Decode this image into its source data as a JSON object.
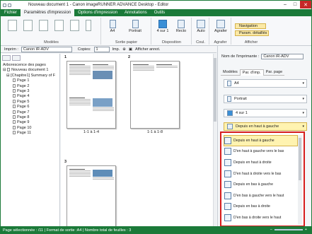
{
  "window": {
    "title": "Nouveau document 1  -  Canon imageRUNNER ADVANCE Desktop - Editor"
  },
  "tabs": [
    "Fichier",
    "Paramètres d'impression",
    "Options d'impression",
    "Annotations",
    "Outils"
  ],
  "ribbon": {
    "modeles_label": "Modèles",
    "sortie_label": "Sortie papier",
    "disposition_label": "Disposition",
    "coul_label": "Coul.",
    "agrafer_label": "Agrafer",
    "afficher_label": "Afficher",
    "paper_size": "A4",
    "orientation": "Portrait",
    "nup": "4 sur 1",
    "duplex": "Recto",
    "color": "Auto",
    "staple": "Agrafer",
    "navigation": "Navigation",
    "param_details": "Param. détaillés"
  },
  "printerbar": {
    "label": "Imprim :",
    "printer": "Canon iR-ADV",
    "copies_label": "Copies:",
    "copies": "1",
    "imp_label": "Imp.",
    "annot_label": "Afficher annot."
  },
  "tree": {
    "title": "Arborescence des pages",
    "root": "Nouveau document 1",
    "chapter": "[Chapitre1] Summary of F",
    "pages": [
      "Page 1",
      "Page 2",
      "Page 3",
      "Page 4",
      "Page 5",
      "Page 6",
      "Page 7",
      "Page 8",
      "Page 9",
      "Page 10",
      "Page 11"
    ]
  },
  "center": {
    "n1": "1",
    "n2": "2",
    "n3": "3",
    "cap1": "1-1 à 1-4",
    "cap2": "1-1 à 1-8"
  },
  "right": {
    "printer_label": "Nom de l'imprimante :",
    "printer": "Canon iR-ADV",
    "tabs": [
      "Modèles",
      "Par. d'imp.",
      "Par. page"
    ],
    "paper": "A4",
    "orientation": "Portrait",
    "nup": "4 sur 1",
    "order": "Depuis en haut à gauche"
  },
  "dropdown": {
    "items": [
      "Depuis en haut à gauche",
      "D'en haut à gauche vers le bas",
      "Depuis en haut à droite",
      "D'en haut à droite vers le bas",
      "Depuis en bas à gauche",
      "D'en bas à gauche vers le haut",
      "Depuis en bas à droite",
      "D'en bas à droite vers le haut"
    ]
  },
  "status": {
    "text": "Page sélectionnée : /11  |  Format de sortie :A4  |  Nombre total de feuilles : 3",
    "zoom": "□"
  }
}
